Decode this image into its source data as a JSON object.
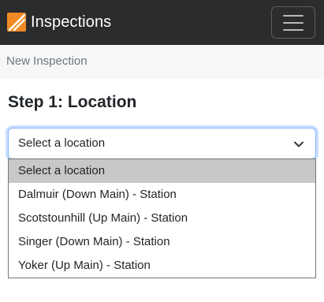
{
  "navbar": {
    "brand_title": "Inspections",
    "logo_icon": "slash-logo-icon",
    "menu_icon": "hamburger-menu-icon",
    "colors": {
      "background": "#2b2c2e",
      "logo": "#f08a24"
    }
  },
  "breadcrumb": {
    "current": "New Inspection"
  },
  "main": {
    "step_title": "Step 1: Location",
    "location_select": {
      "selected": "Select a location",
      "options": [
        "Select a location",
        "Dalmuir (Down Main) - Station",
        "Scotstounhill (Up Main) - Station",
        "Singer (Down Main) - Station",
        "Yoker (Up Main) - Station"
      ],
      "highlighted_index": 0
    }
  }
}
